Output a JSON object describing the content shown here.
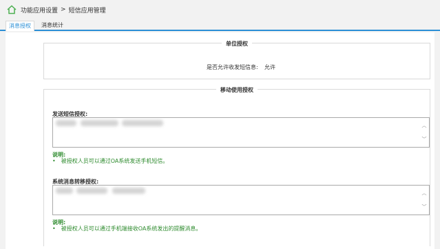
{
  "breadcrumb": {
    "icon": "home-icon",
    "parent": "功能应用设置",
    "separator": ">",
    "current": "短信应用管理"
  },
  "tabs": [
    {
      "label": "消息授权",
      "active": true
    },
    {
      "label": "消息统计",
      "active": false
    }
  ],
  "unit_section": {
    "legend": "单位授权",
    "allow_label": "是否允许收发短信息:",
    "allow_value": "允许"
  },
  "mobile_section": {
    "legend": "移动使用授权",
    "sms": {
      "label": "发送短信授权:",
      "note_title": "说明:",
      "note_item": "被授权人员可以通过OA系统发送手机短信。"
    },
    "forward": {
      "label": "系统消息转移授权:",
      "note_title": "说明:",
      "note_item": "被授权人员可以通过手机端接收OA系统发出的提醒消息。"
    }
  },
  "colors": {
    "accent": "#2b8fd6",
    "note_green": "#2e8b2e",
    "home_icon_green": "#4caf50"
  }
}
